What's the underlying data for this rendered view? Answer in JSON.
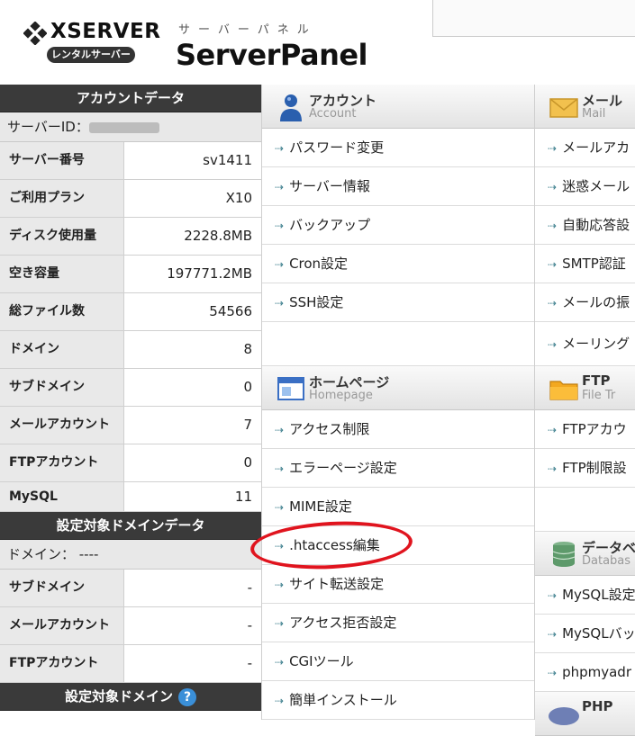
{
  "header": {
    "logo_text": "XSERVER",
    "badge": "レンタルサーバー",
    "panel_sub": "サーバーパネル",
    "panel_title": "ServerPanel"
  },
  "account": {
    "heading": "アカウントデータ",
    "server_id_label": "サーバーID：",
    "rows": [
      {
        "label": "サーバー番号",
        "value": "sv1411"
      },
      {
        "label": "ご利用プラン",
        "value": "X10"
      },
      {
        "label": "ディスク使用量",
        "value": "2228.8MB"
      },
      {
        "label": "空き容量",
        "value": "197771.2MB"
      },
      {
        "label": "総ファイル数",
        "value": "54566"
      },
      {
        "label": "ドメイン",
        "value": "8"
      },
      {
        "label": "サブドメイン",
        "value": "0"
      },
      {
        "label": "メールアカウント",
        "value": "7"
      },
      {
        "label": "FTPアカウント",
        "value": "0"
      },
      {
        "label": "MySQL",
        "value": "11"
      }
    ]
  },
  "domain_data": {
    "heading": "設定対象ドメインデータ",
    "domain_line": "ドメイン： ----",
    "rows": [
      {
        "label": "サブドメイン",
        "value": "-"
      },
      {
        "label": "メールアカウント",
        "value": "-"
      },
      {
        "label": "FTPアカウント",
        "value": "-"
      }
    ]
  },
  "target_domain": {
    "heading": "設定対象ドメイン",
    "help": "?"
  },
  "menu_mid": {
    "account": {
      "ja": "アカウント",
      "en": "Account",
      "items": [
        "パスワード変更",
        "サーバー情報",
        "バックアップ",
        "Cron設定",
        "SSH設定"
      ]
    },
    "homepage": {
      "ja": "ホームページ",
      "en": "Homepage",
      "items": [
        "アクセス制限",
        "エラーページ設定",
        "MIME設定",
        ".htaccess編集",
        "サイト転送設定",
        "アクセス拒否設定",
        "CGIツール",
        "簡単インストール"
      ]
    }
  },
  "menu_right": {
    "mail": {
      "ja": "メール",
      "en": "Mail",
      "items": [
        "メールアカ",
        "迷惑メール",
        "自動応答設",
        "SMTP認証",
        "メールの振",
        "メーリング"
      ]
    },
    "ftp": {
      "ja": "FTP",
      "en": "File Tr",
      "items": [
        "FTPアカウ",
        "FTP制限設"
      ]
    },
    "db": {
      "ja": "データベ",
      "en": "Databas",
      "items": [
        "MySQL設定",
        "MySQLバッ",
        "phpmyadr"
      ]
    },
    "php": {
      "ja": "PHP",
      "en": ""
    }
  },
  "arrow_glyph": "⇢",
  "colors": {
    "highlight_circle": "#e0141e",
    "help_icon": "#3a8fd8"
  }
}
